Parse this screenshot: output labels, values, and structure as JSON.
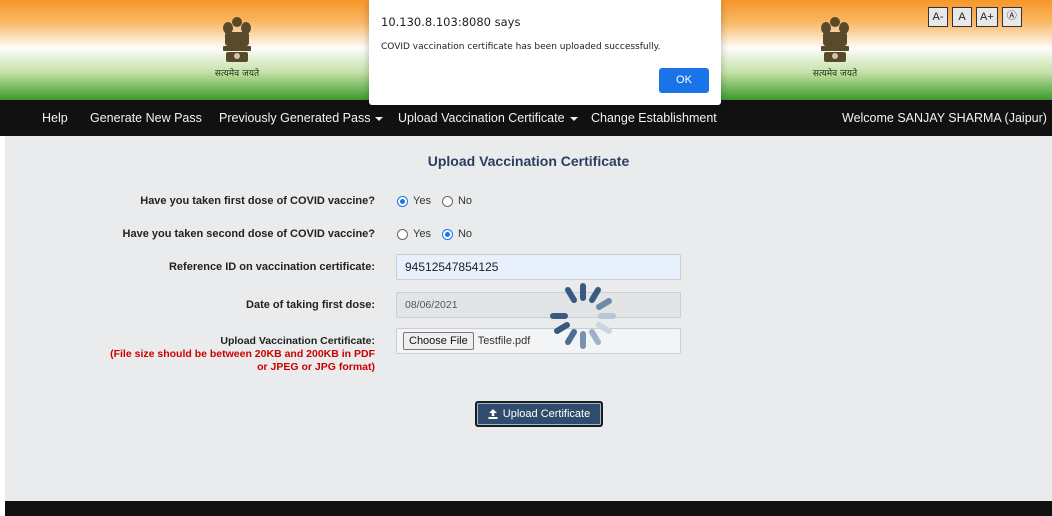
{
  "header": {
    "motto": "सत्यमेव जयते",
    "font_controls": [
      "A-",
      "A",
      "A+",
      "Ⓐ"
    ],
    "colors": {
      "saffron": "#f7962a",
      "green": "#3e9a2b"
    }
  },
  "nav": {
    "items": [
      {
        "label": "Help",
        "dropdown": false
      },
      {
        "label": "Generate New Pass",
        "dropdown": false
      },
      {
        "label": "Previously Generated Pass",
        "dropdown": true
      },
      {
        "label": "Upload Vaccination Certificate",
        "dropdown": true
      },
      {
        "label": "Change Establishment",
        "dropdown": false
      }
    ],
    "welcome": "Welcome SANJAY SHARMA (Jaipur)"
  },
  "form": {
    "title": "Upload Vaccination Certificate",
    "first_dose": {
      "label": "Have you taken first dose of COVID vaccine?",
      "yes": "Yes",
      "no": "No",
      "selected": "Yes"
    },
    "second_dose": {
      "label": "Have you taken second dose of COVID vaccine?",
      "yes": "Yes",
      "no": "No",
      "selected": "No"
    },
    "reference": {
      "label": "Reference ID on vaccination certificate:",
      "value": "94512547854125"
    },
    "date": {
      "label": "Date of taking first dose:",
      "value": "08/06/2021"
    },
    "upload": {
      "label": "Upload Vaccination Certificate:",
      "note_line1": "(File size should be between 20KB and 200KB in PDF",
      "note_line2": "or JPEG or JPG format)",
      "choose_label": "Choose File",
      "file_name": "Testfile.pdf"
    },
    "submit_label": "Upload Certificate",
    "submit_icon": "upload-icon",
    "loading": true
  },
  "dialog": {
    "origin": "10.130.8.103:8080 says",
    "message": "COVID vaccination certificate has been uploaded successfully.",
    "ok_label": "OK"
  }
}
